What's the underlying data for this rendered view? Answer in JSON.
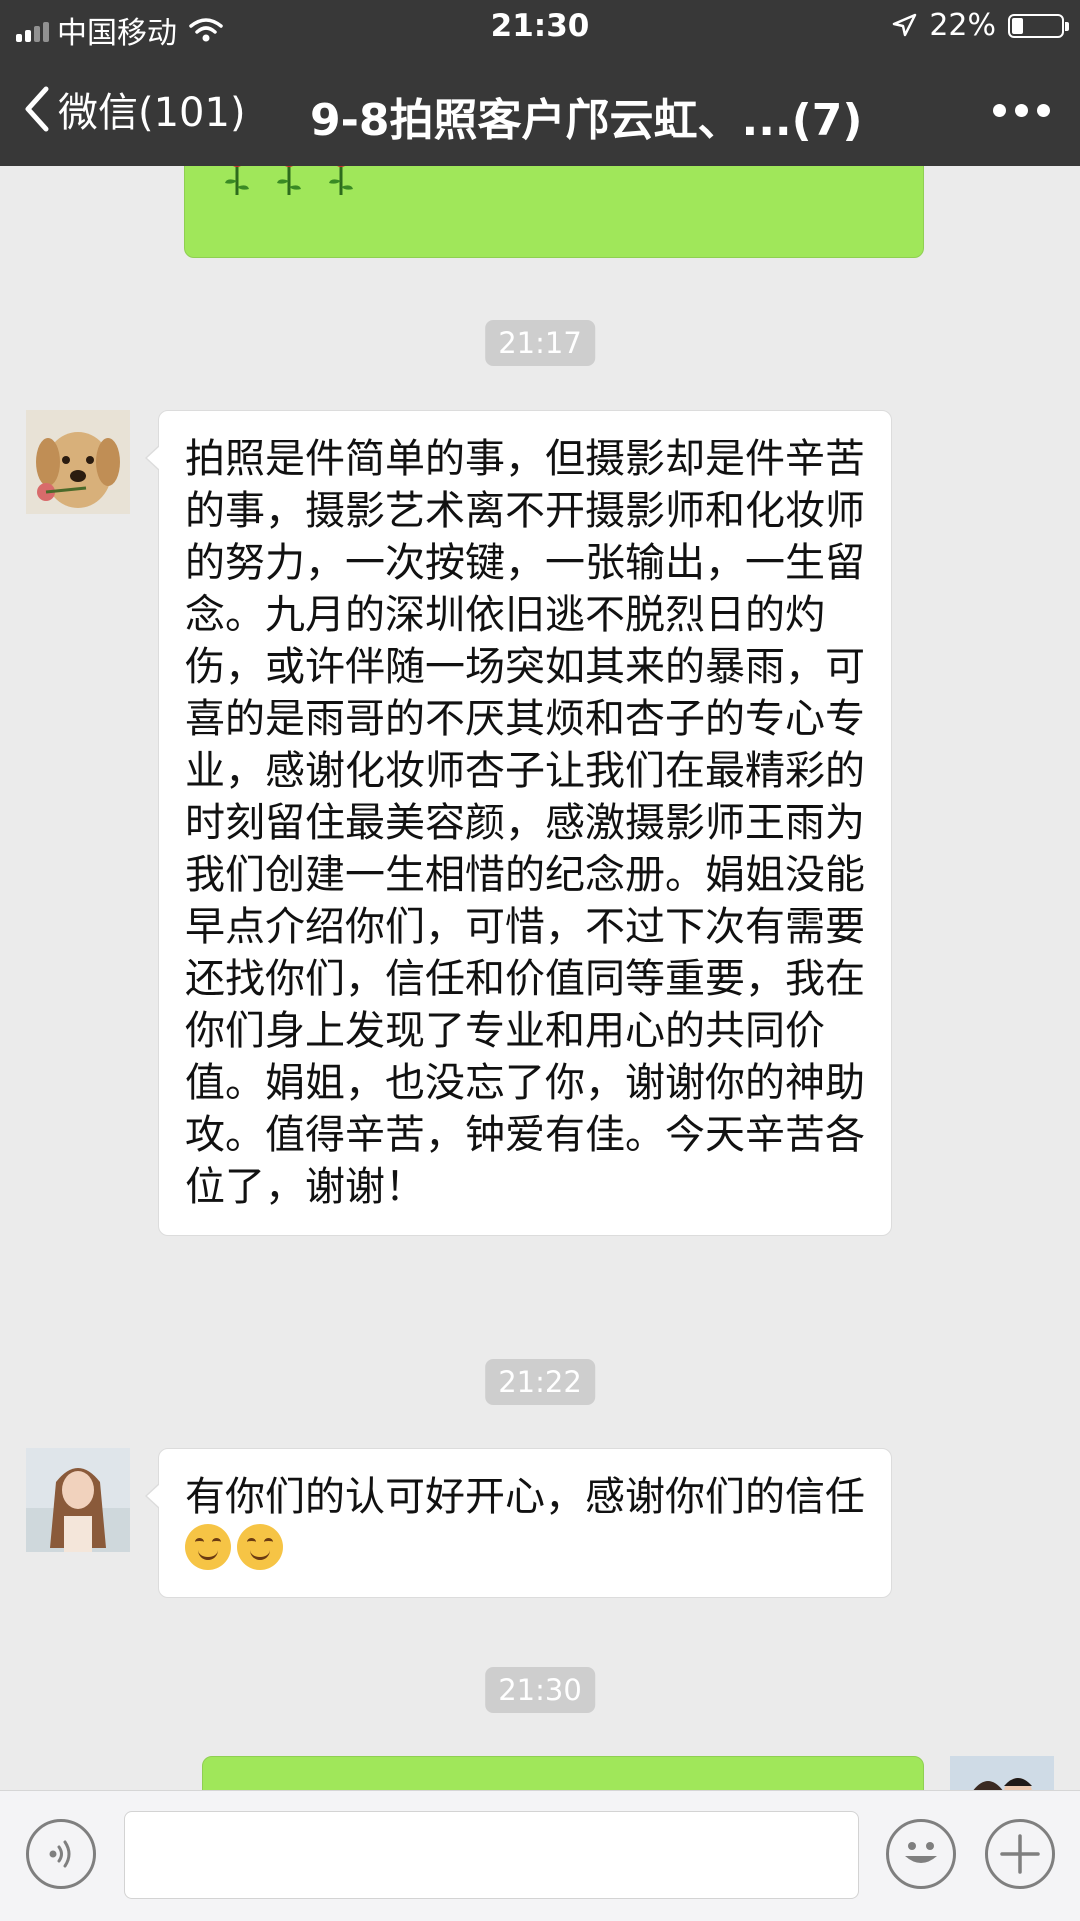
{
  "status_bar": {
    "carrier": "中国移动",
    "time": "21:30",
    "battery_percent": "22%",
    "battery_level": 0.22
  },
  "nav": {
    "back_label": "微信(101)",
    "title": "9-8拍照客户邝云虹、...(7)"
  },
  "messages": {
    "time_1": "21:17",
    "message_1": "拍照是件简单的事，但摄影却是件辛苦的事，摄影艺术离不开摄影师和化妆师的努力，一次按键，一张输出，一生留念。九月的深圳依旧逃不脱烈日的灼伤，或许伴随一场突如其来的暴雨，可喜的是雨哥的不厌其烦和杏子的专心专业，感谢化妆师杏子让我们在最精彩的时刻留住最美容颜，感激摄影师王雨为我们创建一生相惜的纪念册。娟姐没能早点介绍你们，可惜，不过下次有需要还找你们，信任和价值同等重要，我在你们身上发现了专业和用心的共同价值。娟姐，也没忘了你，谢谢你的神助攻。值得辛苦，钟爱有佳。今天辛苦各位了，谢谢！",
    "time_2": "21:22",
    "message_2": "有你们的认可好开心，感谢你们的信任",
    "time_3": "21:30"
  },
  "colors": {
    "nav_bg": "#383838",
    "chat_bg": "#ebebeb",
    "outgoing_bubble": "#a0e75a",
    "incoming_bubble": "#ffffff"
  },
  "icons": [
    "chevron-left-icon",
    "more-icon",
    "voice-icon",
    "emoji-icon",
    "plus-icon",
    "rose-icon",
    "smile-emoji-icon",
    "signal-icon",
    "wifi-icon",
    "location-arrow-icon",
    "battery-icon"
  ]
}
